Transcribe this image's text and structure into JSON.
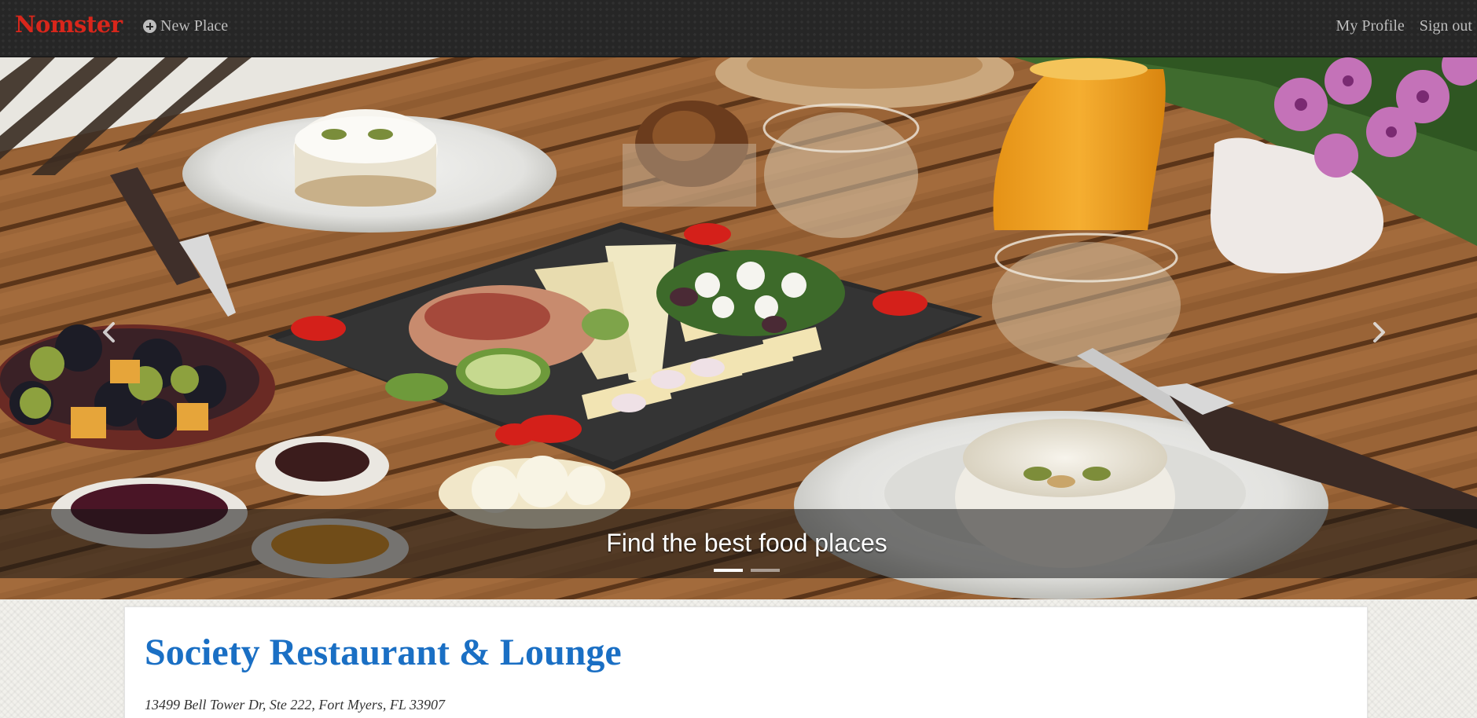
{
  "navbar": {
    "brand": "Nomster",
    "new_place_label": "New Place",
    "profile_label": "My Profile",
    "signout_label": "Sign out"
  },
  "carousel": {
    "caption": "Find the best food places",
    "slide_count": 2,
    "active_slide": 1
  },
  "place": {
    "name": "Society Restaurant & Lounge",
    "address": "13499 Bell Tower Dr, Ste 222, Fort Myers, FL 33907"
  },
  "colors": {
    "brand": "#d8261b",
    "navbar": "#262626",
    "title": "#1a6fc4"
  }
}
